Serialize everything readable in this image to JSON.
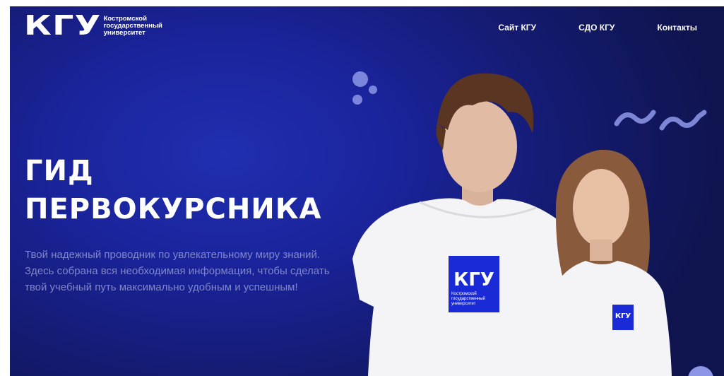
{
  "header": {
    "logo_mark": "КГУ",
    "logo_lines": [
      "Костромской",
      "государственный",
      "университет"
    ],
    "nav": [
      "Сайт КГУ",
      "СДО КГУ",
      "Контакты"
    ]
  },
  "hero": {
    "title_lines": [
      "ГИД",
      "ПЕРВОКУРСНИКА"
    ],
    "subtitle": "Твой надежный проводник по увлекательному миру знаний. Здесь собрана вся необходимая информация, чтобы сделать твой учебный путь максимально удобным и успешным!",
    "shirt_logo": "КГУ",
    "shirt_text_lines": [
      "Костромской",
      "государственный",
      "университет"
    ]
  },
  "colors": {
    "background": "#1a239a",
    "accent_shape": "#8d96e6",
    "shirt_badge": "#1a2ad6",
    "subtitle": "#7f86c9"
  },
  "icons": [
    "decor-dots-icon",
    "decor-waves-icon"
  ]
}
